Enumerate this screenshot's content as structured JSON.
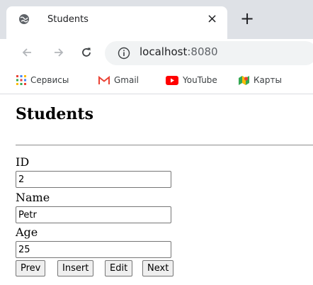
{
  "browser": {
    "tab": {
      "title": "Students",
      "favicon": "globe-icon",
      "close_glyph": "×"
    },
    "new_tab_glyph": "+",
    "address": {
      "host": "localhost",
      "port": ":8080"
    },
    "bookmarks": [
      {
        "label": "Сервисы",
        "icon": "apps-grid-icon"
      },
      {
        "label": "Gmail",
        "icon": "gmail-icon"
      },
      {
        "label": "YouTube",
        "icon": "youtube-icon"
      },
      {
        "label": "Карты",
        "icon": "maps-icon"
      }
    ]
  },
  "page": {
    "title": "Students",
    "fields": [
      {
        "label": "ID",
        "value": "2"
      },
      {
        "label": "Name",
        "value": "Petr"
      },
      {
        "label": "Age",
        "value": "25"
      }
    ],
    "buttons": {
      "prev": "Prev",
      "insert": "Insert",
      "edit": "Edit",
      "next": "Next"
    }
  }
}
